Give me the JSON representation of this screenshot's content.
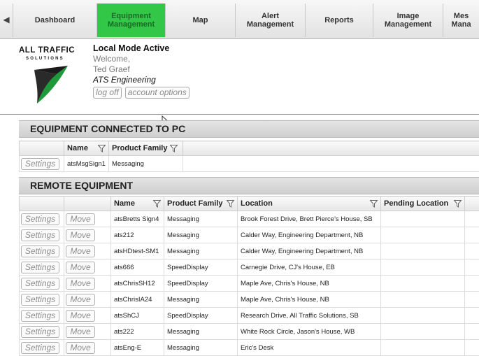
{
  "nav": {
    "tabs": [
      {
        "label": "Dashboard",
        "name": "tab-dashboard",
        "width": 120,
        "active": false
      },
      {
        "label": "Equipment\nManagement",
        "name": "tab-equipment-management",
        "width": 98,
        "active": true
      },
      {
        "label": "Map",
        "name": "tab-map",
        "width": 100,
        "active": false
      },
      {
        "label": "Alert\nManagement",
        "name": "tab-alert-management",
        "width": 100,
        "active": false
      },
      {
        "label": "Reports",
        "name": "tab-reports",
        "width": 97,
        "active": false
      },
      {
        "label": "Image\nManagement",
        "name": "tab-image-management",
        "width": 100,
        "active": false
      },
      {
        "label": "Mes\nMana",
        "name": "tab-message-management",
        "width": 52,
        "active": false
      }
    ]
  },
  "logo": {
    "line1": "ALL TRAFFIC",
    "line2": "SOLUTIONS"
  },
  "welcome": {
    "mode": "Local Mode Active",
    "greeting": "Welcome,",
    "user": "Ted Graef",
    "company": "ATS Engineering",
    "logoff": "log off",
    "account": "account options"
  },
  "connected": {
    "title": "EQUIPMENT CONNECTED TO PC",
    "headers": [
      "",
      "Name",
      "Product Family"
    ],
    "rows": [
      {
        "button": "Settings",
        "name": "atsMsgSign1",
        "family": "Messaging"
      }
    ]
  },
  "remote": {
    "title": "REMOTE EQUIPMENT",
    "headers": [
      "",
      "",
      "Name",
      "Product Family",
      "Location",
      "Pending Location"
    ],
    "settings_label": "Settings",
    "move_label": "Move",
    "rows": [
      {
        "name": "atsBretts Sign4",
        "family": "Messaging",
        "location": "Brook Forest Drive, Brett Pierce's House, SB",
        "pending": ""
      },
      {
        "name": "ats212",
        "family": "Messaging",
        "location": "Calder Way, Engineering Department, NB",
        "pending": ""
      },
      {
        "name": "atsHDtest-SM1",
        "family": "Messaging",
        "location": "Calder Way, Engineering Department, NB",
        "pending": ""
      },
      {
        "name": "ats666",
        "family": "SpeedDisplay",
        "location": "Carnegie Drive, CJ's House, EB",
        "pending": ""
      },
      {
        "name": "atsChrisSH12",
        "family": "SpeedDisplay",
        "location": "Maple Ave, Chris's House, NB",
        "pending": ""
      },
      {
        "name": "atsChrisIA24",
        "family": "Messaging",
        "location": "Maple Ave, Chris's House, NB",
        "pending": ""
      },
      {
        "name": "atsShCJ",
        "family": "SpeedDisplay",
        "location": "Research Drive, All Traffic Solutions, SB",
        "pending": ""
      },
      {
        "name": "ats222",
        "family": "Messaging",
        "location": "White Rock Circle, Jason's House, WB",
        "pending": ""
      },
      {
        "name": "atsEng-E",
        "family": "Messaging",
        "location": "Eric's Desk",
        "pending": ""
      }
    ]
  },
  "colors": {
    "active_tab": "#33c748",
    "logo_green": "#1f9a3b"
  }
}
